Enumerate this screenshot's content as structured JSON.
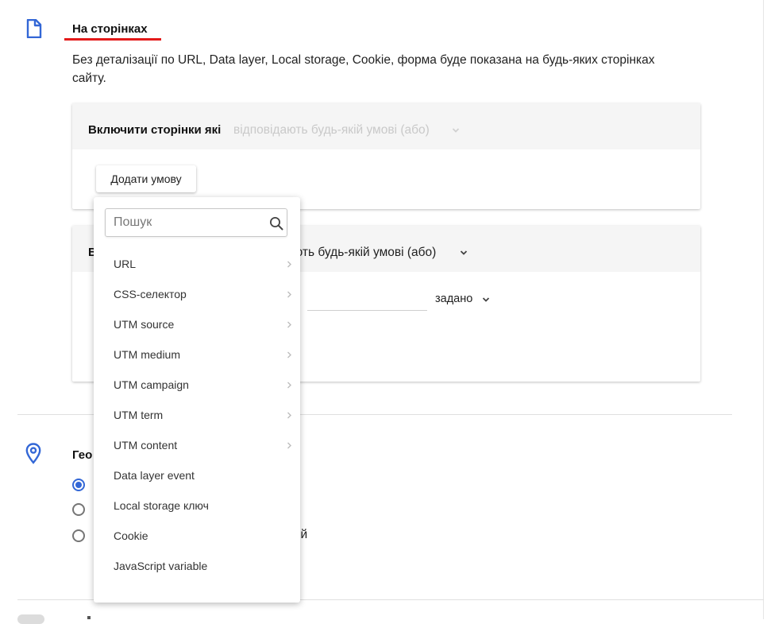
{
  "pages_section": {
    "title": "На сторінках",
    "description": "Без деталізації по URL, Data layer, Local storage, Cookie, форма буде показана на будь-яких сторінках сайту."
  },
  "include_card": {
    "heading": "Включити сторінки які",
    "condition": "відповідають будь-якій умові (або)",
    "add_condition_label": "Додати умову"
  },
  "second_card": {
    "heading_letter": "В",
    "condition": "ають будь-якій умові (або)",
    "operator": "задано"
  },
  "dropdown": {
    "search_placeholder": "Пошук",
    "items": [
      {
        "label": "URL",
        "has_submenu": true
      },
      {
        "label": "CSS-селектор",
        "has_submenu": true
      },
      {
        "label": "UTM source",
        "has_submenu": true
      },
      {
        "label": "UTM medium",
        "has_submenu": true
      },
      {
        "label": "UTM campaign",
        "has_submenu": true
      },
      {
        "label": "UTM term",
        "has_submenu": true
      },
      {
        "label": "UTM content",
        "has_submenu": true
      },
      {
        "label": "Data layer event",
        "has_submenu": false
      },
      {
        "label": "Local storage ключ",
        "has_submenu": false
      },
      {
        "label": "Cookie",
        "has_submenu": false
      },
      {
        "label": "JavaScript variable",
        "has_submenu": false
      }
    ]
  },
  "geo_section": {
    "title": "Гео",
    "radio_options": [
      {
        "selected": true
      },
      {
        "selected": false
      },
      {
        "selected": false,
        "label_fragment": "ій"
      }
    ]
  },
  "colors": {
    "accent_red": "#e31a1a",
    "accent_blue": "#3367d6"
  },
  "icons": {
    "page": "file-icon",
    "geo": "map-pin-icon",
    "search": "search-icon",
    "chevron": "chevron-down-icon",
    "submenu": "chevron-right-icon"
  }
}
